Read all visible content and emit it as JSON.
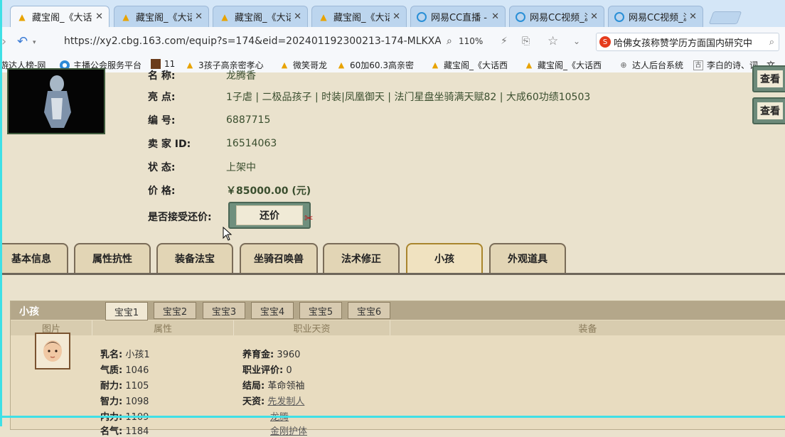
{
  "browser": {
    "tabs": [
      {
        "title": "藏宝阁_《大话",
        "icon": "chick-icon",
        "active": true
      },
      {
        "title": "藏宝阁_《大话",
        "icon": "chick-icon",
        "active": false
      },
      {
        "title": "藏宝阁_《大话",
        "icon": "chick-icon",
        "active": false
      },
      {
        "title": "藏宝阁_《大话",
        "icon": "chick-icon",
        "active": false
      },
      {
        "title": "网易CC直播 -",
        "icon": "cc-icon",
        "active": false
      },
      {
        "title": "网易CC视频_游",
        "icon": "cc-icon",
        "active": false
      },
      {
        "title": "网易CC视频_游",
        "icon": "cc-icon",
        "active": false
      }
    ],
    "url": "https://xy2.cbg.163.com/equip?s=174&eid=202401192300213-174-MLKXAXTA/",
    "zoom": "110%",
    "search_text": "哈佛女孩称赞学历方面国内研究中",
    "bookmarks": [
      {
        "label": "游达人榜-网",
        "icon": "none"
      },
      {
        "label": "主播公会服务平台",
        "icon": "blue"
      },
      {
        "label": "11",
        "icon": "img"
      },
      {
        "label": "3孩子高亲密孝心",
        "icon": "chick"
      },
      {
        "label": "微笑哥龙",
        "icon": "chick"
      },
      {
        "label": "60加60.3高亲密",
        "icon": "chick"
      },
      {
        "label": "藏宝阁_《大话西",
        "icon": "chick"
      },
      {
        "label": "藏宝阁_《大话西",
        "icon": "chick"
      },
      {
        "label": "达人后台系统",
        "icon": "globe"
      },
      {
        "label": "李白的诗、词、文",
        "icon": "gu"
      }
    ]
  },
  "item": {
    "name_label_partial": "名         称:",
    "name_value_partial": "龙腾香",
    "highlights_label": "亮         点:",
    "highlights_value": "1子虐 | 二极品孩子 | 时装|凤凰御天 | 法门星盘坐骑满天赋82 | 大成60功绩10503",
    "serial_label": "编         号:",
    "serial_value": "6887715",
    "seller_label": "卖  家   ID:",
    "seller_value": "16514063",
    "status_label": "状         态:",
    "status_value": "上架中",
    "price_label": "价         格:",
    "price_value": "￥85000.00 (元)",
    "counter_label": "是否接受还价:",
    "counter_button": "还价",
    "side_buttons": [
      "查看",
      "查看"
    ]
  },
  "main_tabs": [
    "基本信息",
    "属性抗性",
    "装备法宝",
    "坐骑召唤兽",
    "法术修正",
    "小孩",
    "外观道具"
  ],
  "active_main_tab": "小孩",
  "child_panel": {
    "title": "小孩",
    "baby_tabs": [
      "宝宝1",
      "宝宝2",
      "宝宝3",
      "宝宝4",
      "宝宝5",
      "宝宝6"
    ],
    "active_baby_tab": "宝宝1",
    "columns": [
      "图片",
      "属性",
      "职业天资",
      "装备"
    ],
    "attributes": [
      {
        "label": "乳名:",
        "value": "小孩1"
      },
      {
        "label": "气质:",
        "value": "1046"
      },
      {
        "label": "耐力:",
        "value": "1105"
      },
      {
        "label": "智力:",
        "value": "1098"
      },
      {
        "label": "内力:",
        "value": "1109"
      },
      {
        "label": "名气:",
        "value": "1184"
      }
    ],
    "career": [
      {
        "label": "养育金:",
        "value": "3960"
      },
      {
        "label": "职业评价:",
        "value": "0"
      },
      {
        "label": "结局:",
        "value": "革命领袖"
      },
      {
        "label": "天资:",
        "value": "先发制人"
      }
    ],
    "talents_extra": [
      "龙腾",
      "金刚护体"
    ]
  }
}
